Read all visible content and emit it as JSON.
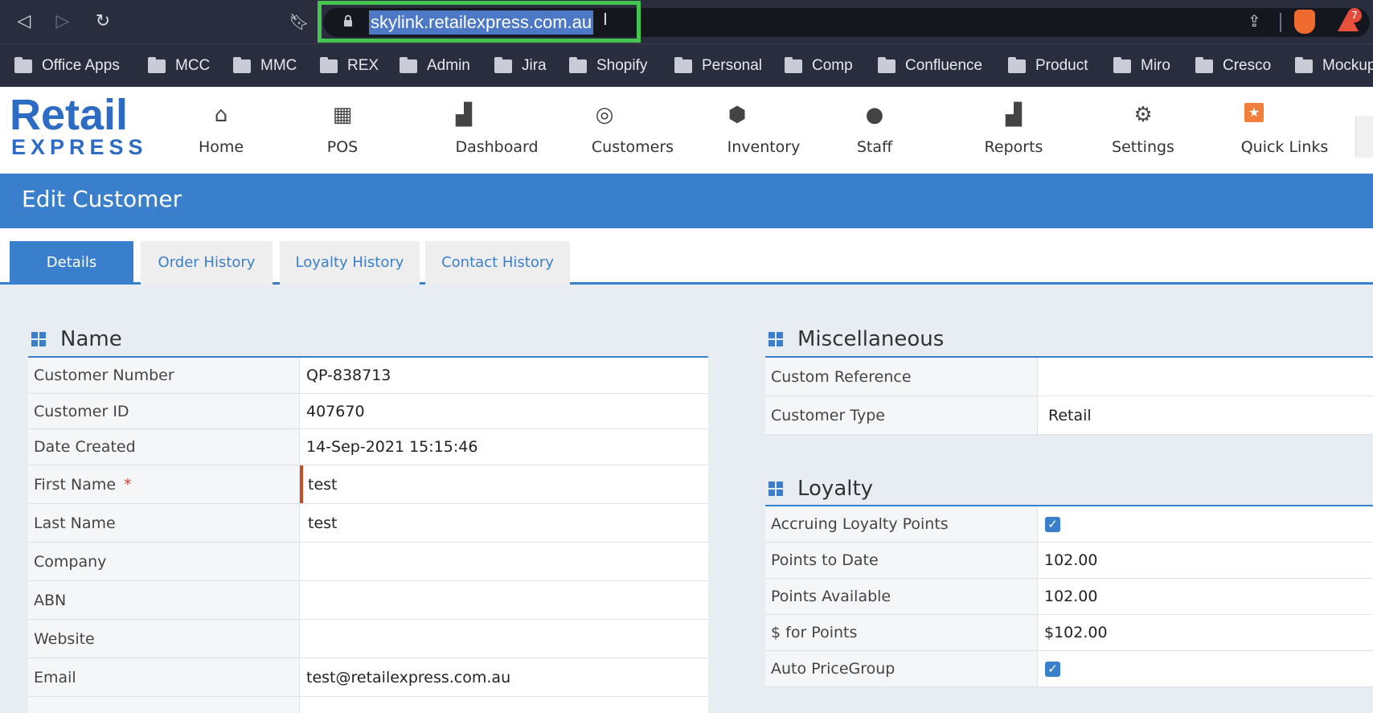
{
  "browser": {
    "url": "skylink.retailexpress.com.au",
    "rewards_count": "7",
    "bookmarks": [
      "Office Apps",
      "MCC",
      "MMC",
      "REX",
      "Admin",
      "Jira",
      "Shopify",
      "Personal",
      "Comp",
      "Confluence",
      "Product",
      "Miro",
      "Cresco",
      "Mockup"
    ]
  },
  "app": {
    "logo_main": "Retail",
    "logo_sub": "EXPRESS",
    "nav": [
      {
        "label": "Home",
        "icon": "home-icon"
      },
      {
        "label": "POS",
        "icon": "store-icon"
      },
      {
        "label": "Dashboard",
        "icon": "bar-chart-icon"
      },
      {
        "label": "Customers",
        "icon": "target-icon"
      },
      {
        "label": "Inventory",
        "icon": "box-icon"
      },
      {
        "label": "Staff",
        "icon": "person-icon"
      },
      {
        "label": "Reports",
        "icon": "bar-chart-icon"
      },
      {
        "label": "Settings",
        "icon": "gear-icon"
      },
      {
        "label": "Quick Links",
        "icon": "star-icon"
      }
    ],
    "accent": "#3a7fcc"
  },
  "page": {
    "title": "Edit Customer",
    "tabs": [
      "Details",
      "Order History",
      "Loyalty History",
      "Contact History"
    ],
    "active_tab": "Details"
  },
  "name_section": {
    "heading": "Name",
    "rows": [
      {
        "label": "Customer Number",
        "value": "QP-838713"
      },
      {
        "label": "Customer ID",
        "value": "407670"
      },
      {
        "label": "Date Created",
        "value": "14-Sep-2021 15:15:46"
      },
      {
        "label": "First Name",
        "value": "test",
        "required": "*"
      },
      {
        "label": "Last Name",
        "value": "test"
      },
      {
        "label": "Company",
        "value": ""
      },
      {
        "label": "ABN",
        "value": ""
      },
      {
        "label": "Website",
        "value": ""
      },
      {
        "label": "Email",
        "value": "test@retailexpress.com.au"
      }
    ]
  },
  "misc_section": {
    "heading": "Miscellaneous",
    "rows": [
      {
        "label": "Custom Reference",
        "value": ""
      },
      {
        "label": "Customer Type",
        "value": "Retail"
      }
    ]
  },
  "loyalty_section": {
    "heading": "Loyalty",
    "rows": [
      {
        "label": "Accruing Loyalty Points",
        "checked": true
      },
      {
        "label": "Points to Date",
        "value": "102.00"
      },
      {
        "label": "Points Available",
        "value": "102.00"
      },
      {
        "label": "$ for Points",
        "value": "$102.00"
      },
      {
        "label": "Auto PriceGroup",
        "checked": true
      }
    ]
  }
}
